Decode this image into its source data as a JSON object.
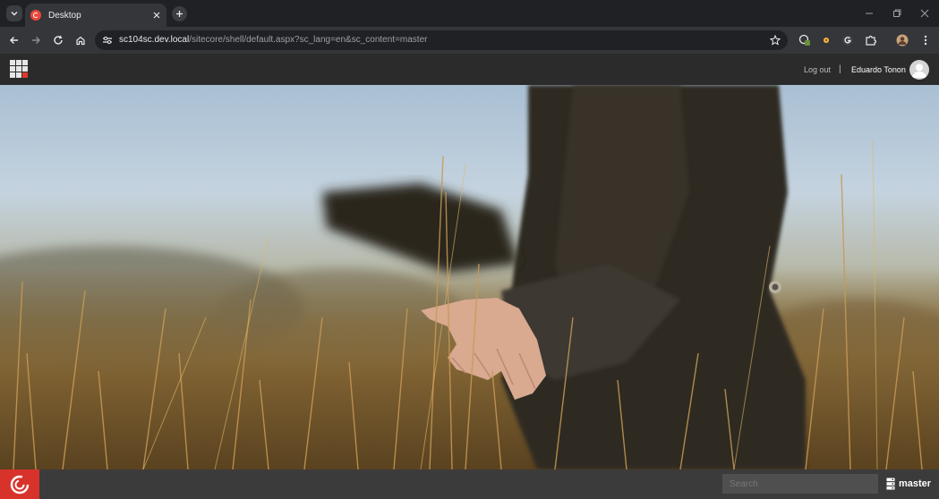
{
  "browser": {
    "tab_title": "Desktop",
    "url_host": "sc104sc.dev.local",
    "url_path": "/sitecore/shell/default.aspx?sc_lang=en&sc_content=master"
  },
  "header": {
    "logout_label": "Log out",
    "separator": "|",
    "user_name": "Eduardo Tonon"
  },
  "taskbar": {
    "search_placeholder": "Search",
    "database_label": "master"
  },
  "colors": {
    "accent": "#d8332b",
    "header_bg": "#2b2b2b",
    "taskbar_bg": "#3b3b3b"
  },
  "icons": [
    "tab-search-icon",
    "sitecore-favicon",
    "close-icon",
    "new-tab-icon",
    "minimize-icon",
    "restore-icon",
    "window-close-icon",
    "back-icon",
    "forward-icon",
    "reload-icon",
    "home-icon",
    "site-info-icon",
    "bookmark-star-icon",
    "extension-icon",
    "profile-icon",
    "menu-icon",
    "launchpad-icon",
    "avatar-icon",
    "sitecore-start-icon",
    "database-icon"
  ]
}
